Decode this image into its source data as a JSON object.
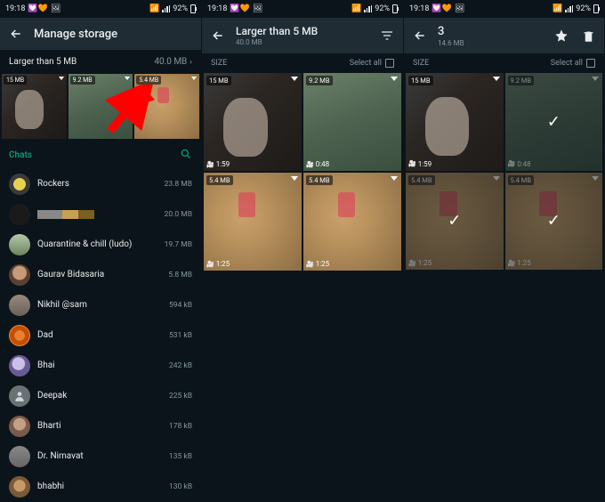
{
  "status": {
    "time": "19:18",
    "battery": "92%",
    "hearts": "💟🧡",
    "icons": "🖼"
  },
  "p1": {
    "toolbar_title": "Manage storage",
    "section_title": "Larger than 5 MB",
    "section_size": "40.0 MB",
    "thumbs": [
      {
        "size": "15 MB"
      },
      {
        "size": "9.2 MB"
      },
      {
        "size": "5.4 MB"
      }
    ],
    "chats_hdr": "Chats",
    "chats": [
      {
        "name": "Rockers",
        "size": "23.8 MB",
        "av": "av-rockers"
      },
      {
        "name": "",
        "size": "20.0 MB",
        "av": "av-420",
        "blurred": true
      },
      {
        "name": "Quarantine & chill (ludo)",
        "size": "19.7 MB",
        "av": "av-quar"
      },
      {
        "name": "Gaurav Bidasaria",
        "size": "5.8 MB",
        "av": "av-gaurav"
      },
      {
        "name": "Nikhil @sam",
        "size": "594 kB",
        "av": "av-nikhil"
      },
      {
        "name": "Dad",
        "size": "531 kB",
        "av": "av-dad"
      },
      {
        "name": "Bhai",
        "size": "242 kB",
        "av": "av-bhai"
      },
      {
        "name": "Deepak",
        "size": "225 kB",
        "av": "av-deepak"
      },
      {
        "name": "Bharti",
        "size": "178 kB",
        "av": "av-bharti"
      },
      {
        "name": "Dr. Nimavat",
        "size": "135 kB",
        "av": "av-dr"
      },
      {
        "name": "bhabhi",
        "size": "130 kB",
        "av": "av-bhabhi"
      }
    ]
  },
  "p2": {
    "toolbar_title": "Larger than 5 MB",
    "toolbar_sub": "40.0 MB",
    "sort_label": "SIZE",
    "select_all": "Select all",
    "items": [
      {
        "size": "15 MB",
        "dur": "1:59",
        "bg": "bg-girl"
      },
      {
        "size": "9.2 MB",
        "dur": "0:48",
        "bg": "bg-water"
      },
      {
        "size": "5.4 MB",
        "dur": "1:25",
        "bg": "bg-kids"
      },
      {
        "size": "5.4 MB",
        "dur": "1:25",
        "bg": "bg-kids"
      }
    ]
  },
  "p3": {
    "toolbar_title": "3",
    "toolbar_sub": "14.6 MB",
    "sort_label": "SIZE",
    "select_all": "Select all",
    "items": [
      {
        "size": "15 MB",
        "dur": "1:59",
        "bg": "bg-girl",
        "sel": false
      },
      {
        "size": "9.2 MB",
        "dur": "0:48",
        "bg": "bg-water",
        "sel": true
      },
      {
        "size": "5.4 MB",
        "dur": "1:25",
        "bg": "bg-kids",
        "sel": true
      },
      {
        "size": "5.4 MB",
        "dur": "1:25",
        "bg": "bg-kids",
        "sel": true
      }
    ]
  }
}
